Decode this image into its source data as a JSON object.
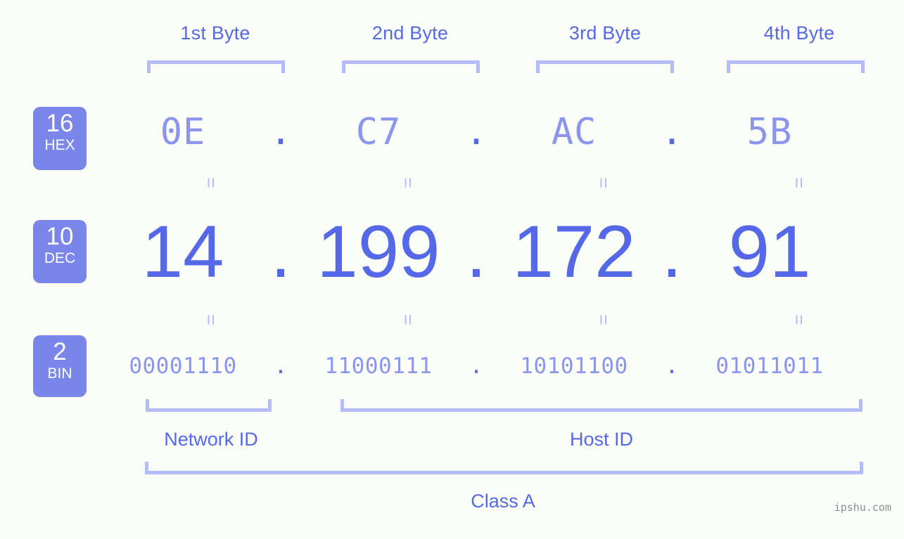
{
  "background_color": "#fbfdf8",
  "accent_color": "#5568e8",
  "accent_light_color": "#8b95ef",
  "bracket_color": "#b4bcfb",
  "badge_color": "#7b86ea",
  "byte_headers": [
    {
      "label": "1st Byte"
    },
    {
      "label": "2nd Byte"
    },
    {
      "label": "3rd Byte"
    },
    {
      "label": "4th Byte"
    }
  ],
  "radix_badges": [
    {
      "number": "16",
      "abbr": "HEX"
    },
    {
      "number": "10",
      "abbr": "DEC"
    },
    {
      "number": "2",
      "abbr": "BIN"
    }
  ],
  "separator": ".",
  "equals_mark": "=",
  "rows": {
    "hex": {
      "radix": "16",
      "name": "HEX",
      "octets": [
        "0E",
        "C7",
        "AC",
        "5B"
      ]
    },
    "dec": {
      "radix": "10",
      "name": "DEC",
      "octets": [
        "14",
        "199",
        "172",
        "91"
      ]
    },
    "bin": {
      "radix": "2",
      "name": "BIN",
      "octets": [
        "00001110",
        "11000111",
        "10101100",
        "01011011"
      ]
    }
  },
  "ip_address": "14.199.172.91",
  "segments": {
    "network_id_label": "Network ID",
    "host_id_label": "Host ID"
  },
  "class_label": "Class A",
  "watermark": "ipshu.com"
}
